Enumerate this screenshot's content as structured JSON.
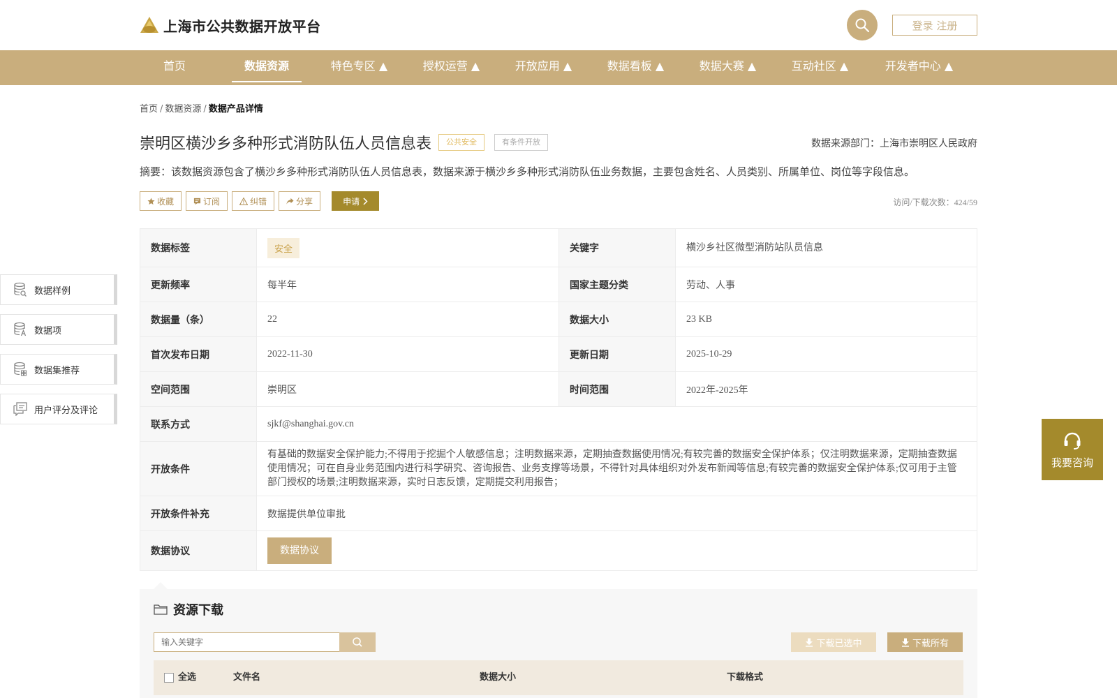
{
  "header": {
    "site_title": "上海市公共数据开放平台",
    "login_label": "登录 注册"
  },
  "nav": {
    "items": [
      {
        "label": "首页"
      },
      {
        "label": "数据资源"
      },
      {
        "label": "特色专区 ▲"
      },
      {
        "label": "授权运营 ▲"
      },
      {
        "label": "开放应用 ▲"
      },
      {
        "label": "数据看板 ▲"
      },
      {
        "label": "数据大赛 ▲"
      },
      {
        "label": "互动社区 ▲"
      },
      {
        "label": "开发者中心 ▲"
      }
    ],
    "active": "数据资源"
  },
  "breadcrumb": {
    "home": "首页",
    "resources": "数据资源",
    "current": "数据产品详情",
    "separator": "/"
  },
  "product": {
    "title": "崇明区横沙乡多种形式消防队伍人员信息表",
    "tag_category": "公共安全",
    "tag_open": "有条件开放",
    "source": "数据来源部门：上海市崇明区人民政府",
    "summary": "摘要：该数据资源包含了横沙乡多种形式消防队伍人员信息表，数据来源于横沙乡多种形式消防队伍业务数据，主要包含姓名、人员类别、所属单位、岗位等字段信息。",
    "visits": "访问/下载次数：424/59"
  },
  "actions": {
    "collect": "收藏",
    "subscribe": "订阅",
    "correct": "纠错",
    "share": "分享",
    "apply": "申请"
  },
  "details": {
    "tag_label": "数据标签",
    "tag_value": "安全",
    "keyword_label": "关键字",
    "keyword_value": "横沙乡社区微型消防站队员信息",
    "freq_label": "更新频率",
    "freq_value": "每半年",
    "theme_label": "国家主题分类",
    "theme_value": "劳动、人事",
    "count_label": "数据量（条）",
    "count_value": "22",
    "size_label": "数据大小",
    "size_value": "23 KB",
    "first_label": "首次发布日期",
    "first_value": "2022-11-30",
    "update_label": "更新日期",
    "update_value": "2025-10-29",
    "space_label": "空间范围",
    "space_value": "崇明区",
    "time_label": "时间范围",
    "time_value": "2022年-2025年",
    "contact_label": "联系方式",
    "contact_value": "sjkf@shanghai.gov.cn",
    "cond_label": "开放条件",
    "cond_value": "有基础的数据安全保护能力;不得用于挖掘个人敏感信息；注明数据来源，定期抽查数据使用情况;有较完善的数据安全保护体系；仅注明数据来源，定期抽查数据使用情况；可在自身业务范围内进行科学研究、咨询报告、业务支撑等场景，不得针对具体组织对外发布新闻等信息;有较完善的数据安全保护体系;仅可用于主管部门授权的场景;注明数据来源，实时日志反馈，定期提交利用报告；",
    "cond_extra_label": "开放条件补充",
    "cond_extra_value": "数据提供单位审批",
    "agreement_label": "数据协议",
    "agreement_button": "数据协议"
  },
  "sidebar": {
    "items": [
      {
        "label": "数据样例",
        "icon": "database-search-icon"
      },
      {
        "label": "数据项",
        "icon": "database-field-icon"
      },
      {
        "label": "数据集推荐",
        "icon": "database-recommend-icon"
      },
      {
        "label": "用户评分及评论",
        "icon": "comment-icon"
      }
    ]
  },
  "consult": {
    "label": "我要咨询"
  },
  "resources": {
    "title": "资源下载",
    "search_placeholder": "输入关键字",
    "download_selected": "下载已选中",
    "download_all": "下载所有",
    "columns": {
      "select_all": "全选",
      "filename": "文件名",
      "size": "数据大小",
      "format": "下载格式"
    }
  },
  "colors": {
    "brand_gold": "#c9ae7d",
    "accent_dark": "#a48a2c"
  }
}
